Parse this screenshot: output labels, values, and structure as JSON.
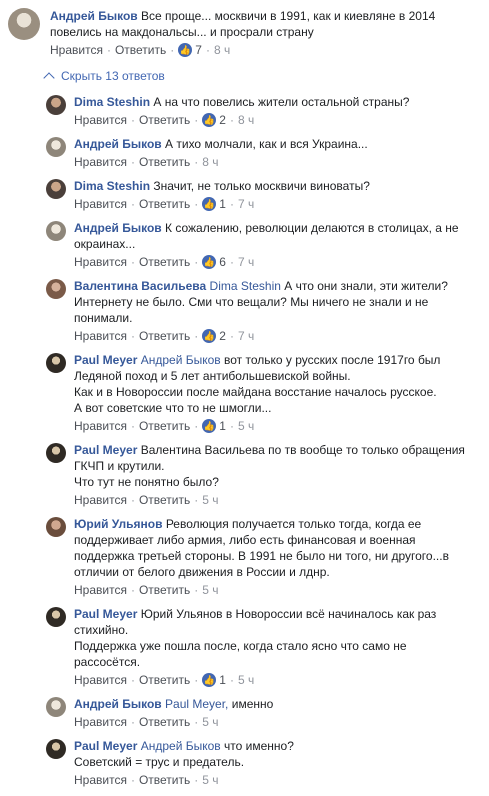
{
  "top_comment": {
    "author": "Андрей Быков",
    "text": "Все проще... москвичи в 1991, как и киевляне в 2014 повелись на макдональсы... и просрали страну",
    "like_label": "Нравится",
    "reply_label": "Ответить",
    "likes": "7",
    "time": "8 ч"
  },
  "collapse_label": "Скрыть 13 ответов",
  "replies": [
    {
      "author": "Dima Steshin",
      "mention": "",
      "text": "А на что повелись жители остальной страны?",
      "likes": "2",
      "time": "8 ч",
      "avatar": "dima"
    },
    {
      "author": "Андрей Быков",
      "mention": "",
      "text": "А тихо молчали, как и вся Украина...",
      "likes": "",
      "time": "8 ч",
      "avatar": "andrey"
    },
    {
      "author": "Dima Steshin",
      "mention": "",
      "text": "Значит, не только москвичи виноваты?",
      "likes": "1",
      "time": "7 ч",
      "avatar": "dima"
    },
    {
      "author": "Андрей Быков",
      "mention": "",
      "text": "К сожалению, революции делаются в столицах, а не окраинах...",
      "likes": "6",
      "time": "7 ч",
      "avatar": "andrey"
    },
    {
      "author": "Валентина Васильева",
      "mention": "Dima Steshin",
      "text": "А что они знали, эти жители? Интернету не было. Сми что вещали? Мы ничего не знали и не понимали.",
      "likes": "2",
      "time": "7 ч",
      "avatar": "val"
    },
    {
      "author": "Paul Meyer",
      "mention": "Андрей Быков",
      "text": "вот только у русских после 1917го был Ледяной поход и 5 лет антибольшевиской войны.\nКак и в Новороссии после майдана восстание началось русское.\nА вот советские что то не шмогли...",
      "likes": "1",
      "time": "5 ч",
      "avatar": "paul"
    },
    {
      "author": "Paul Meyer",
      "mention": "",
      "text": "Валентина Васильева по тв вообще то только обращения ГКЧП и крутили.\nЧто тут не понятно было?",
      "likes": "",
      "time": "5 ч",
      "avatar": "paul"
    },
    {
      "author": "Юрий Ульянов",
      "mention": "",
      "text": "Революция получается только тогда, когда ее поддерживает либо армия, либо есть финансовая и военная поддержка третьей стороны. В 1991 не было ни того, ни другого...в отличии от белого движения в России и лднр.",
      "likes": "",
      "time": "5 ч",
      "avatar": "yuri"
    },
    {
      "author": "Paul Meyer",
      "mention": "",
      "text": "Юрий Ульянов в Новороссии всё начиналось как раз стихийно.\nПоддержка уже пошла после, когда стало ясно что само не рассосётся.",
      "likes": "1",
      "time": "5 ч",
      "avatar": "paul"
    },
    {
      "author": "Андрей Быков",
      "mention": "Paul Meyer,",
      "text": "именно",
      "likes": "",
      "time": "5 ч",
      "avatar": "andrey"
    },
    {
      "author": "Paul Meyer",
      "mention": "Андрей Быков",
      "text": "что именно?\nСоветский = трус и предатель.",
      "likes": "",
      "time": "5 ч",
      "avatar": "paul"
    }
  ],
  "labels": {
    "like": "Нравится",
    "reply": "Ответить"
  },
  "icons": {
    "like": "thumbs-up-icon",
    "collapse": "chevron-up-icon"
  },
  "colors": {
    "link": "#365899",
    "accent": "#4267b2",
    "meta": "#90949c"
  }
}
